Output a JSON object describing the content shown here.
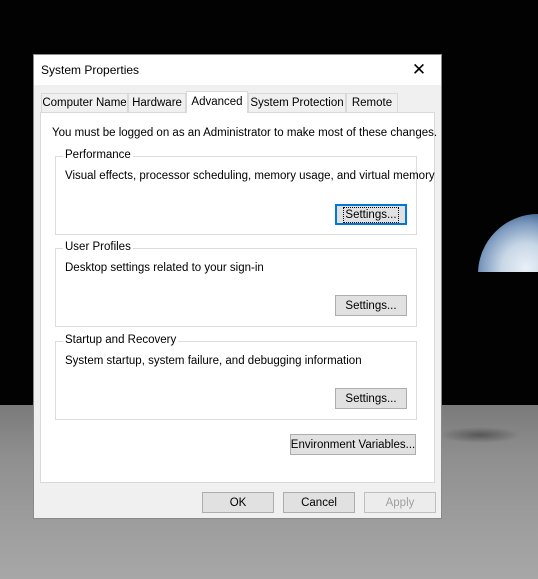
{
  "window": {
    "title": "System Properties",
    "close_glyph": "✕"
  },
  "tabs": [
    {
      "label": "Computer Name"
    },
    {
      "label": "Hardware"
    },
    {
      "label": "Advanced",
      "active": true
    },
    {
      "label": "System Protection"
    },
    {
      "label": "Remote"
    }
  ],
  "advanced": {
    "admin_note": "You must be logged on as an Administrator to make most of these changes.",
    "performance": {
      "title": "Performance",
      "description": "Visual effects, processor scheduling, memory usage, and virtual memory",
      "button": "Settings..."
    },
    "user_profiles": {
      "title": "User Profiles",
      "description": "Desktop settings related to your sign-in",
      "button": "Settings..."
    },
    "startup_recovery": {
      "title": "Startup and Recovery",
      "description": "System startup, system failure, and debugging information",
      "button": "Settings..."
    },
    "env_button": "Environment Variables..."
  },
  "footer": {
    "ok": "OK",
    "cancel": "Cancel",
    "apply": "Apply"
  }
}
